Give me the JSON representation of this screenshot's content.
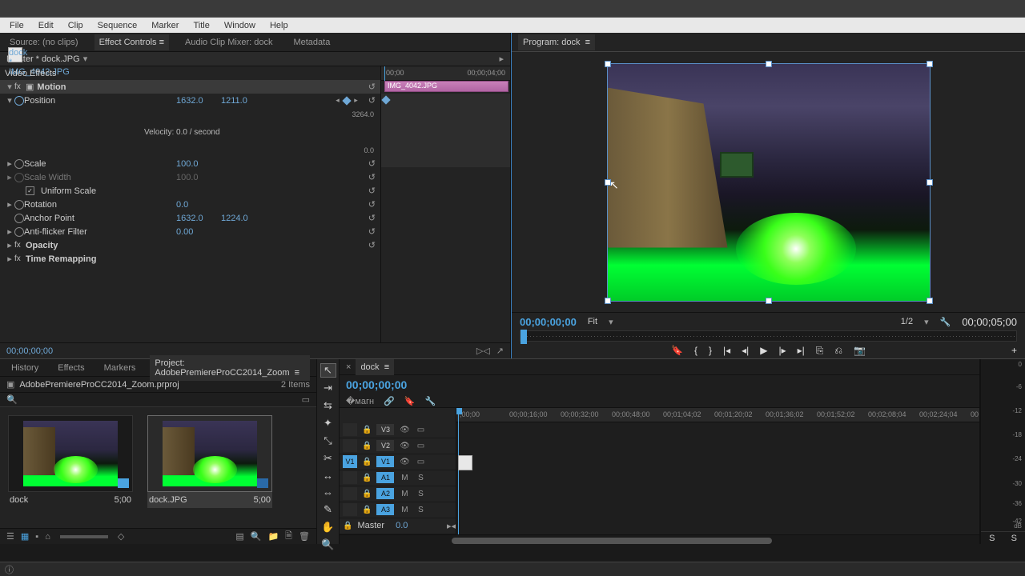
{
  "menubar": [
    "File",
    "Edit",
    "Clip",
    "Sequence",
    "Marker",
    "Title",
    "Window",
    "Help"
  ],
  "leftTabs": {
    "source": "Source: (no clips)",
    "effectControls": "Effect Controls",
    "audioMixer": "Audio Clip Mixer: dock",
    "metadata": "Metadata"
  },
  "ec": {
    "master": "Master * dock.JPG",
    "clip": "dock * IMG_4042.JPG",
    "videoEffects": "Video Effects",
    "motion": "Motion",
    "position": "Position",
    "posX": "1632.0",
    "posY": "1211.0",
    "posMax": "3264.0",
    "posMin": "0.0",
    "velocity": "Velocity: 0.0 / second",
    "scale": "Scale",
    "scaleVal": "100.0",
    "scaleWidth": "Scale Width",
    "scaleWidthVal": "100.0",
    "uniform": "Uniform Scale",
    "rotation": "Rotation",
    "rotationVal": "0.0",
    "anchor": "Anchor Point",
    "anchorX": "1632.0",
    "anchorY": "1224.0",
    "antiflicker": "Anti-flicker Filter",
    "antiflickerVal": "0.00",
    "opacity": "Opacity",
    "timeRemap": "Time Remapping",
    "tlStart": "00;00",
    "tlEnd": "00;00;04;00",
    "tlClip": "IMG_4042.JPG",
    "footerTc": "00;00;00;00"
  },
  "program": {
    "label": "Program: dock",
    "tc": "00;00;00;00",
    "fit": "Fit",
    "half": "1/2",
    "dur": "00;00;05;00"
  },
  "projectTabs": {
    "history": "History",
    "effects": "Effects",
    "markers": "Markers",
    "project": "Project: AdobePremiereProCC2014_Zoom"
  },
  "project": {
    "path": "AdobePremiereProCC2014_Zoom.prproj",
    "items": "2 Items"
  },
  "bins": [
    {
      "name": "dock",
      "dur": "5;00"
    },
    {
      "name": "dock.JPG",
      "dur": "5;00"
    }
  ],
  "timeline": {
    "tab": "dock",
    "tc": "00;00;00;00",
    "ticks": [
      ";00;00",
      "00;00;16;00",
      "00;00;32;00",
      "00;00;48;00",
      "00;01;04;02",
      "00;01;20;02",
      "00;01;36;02",
      "00;01;52;02",
      "00;02;08;04",
      "00;02;24;04",
      "00"
    ],
    "tracks": {
      "v3": "V3",
      "v2": "V2",
      "v1": "V1",
      "a1": "A1",
      "a2": "A2",
      "a3": "A3"
    },
    "master": "Master",
    "masterVal": "0.0",
    "toggles": {
      "m": "M",
      "s": "S",
      "eye": "👁",
      "box": "▭"
    }
  },
  "meters": {
    "labels": [
      "0",
      "-6",
      "-12",
      "-18",
      "-24",
      "-30",
      "-36",
      "-42",
      "dB"
    ],
    "s": "S",
    "solo": "S"
  }
}
